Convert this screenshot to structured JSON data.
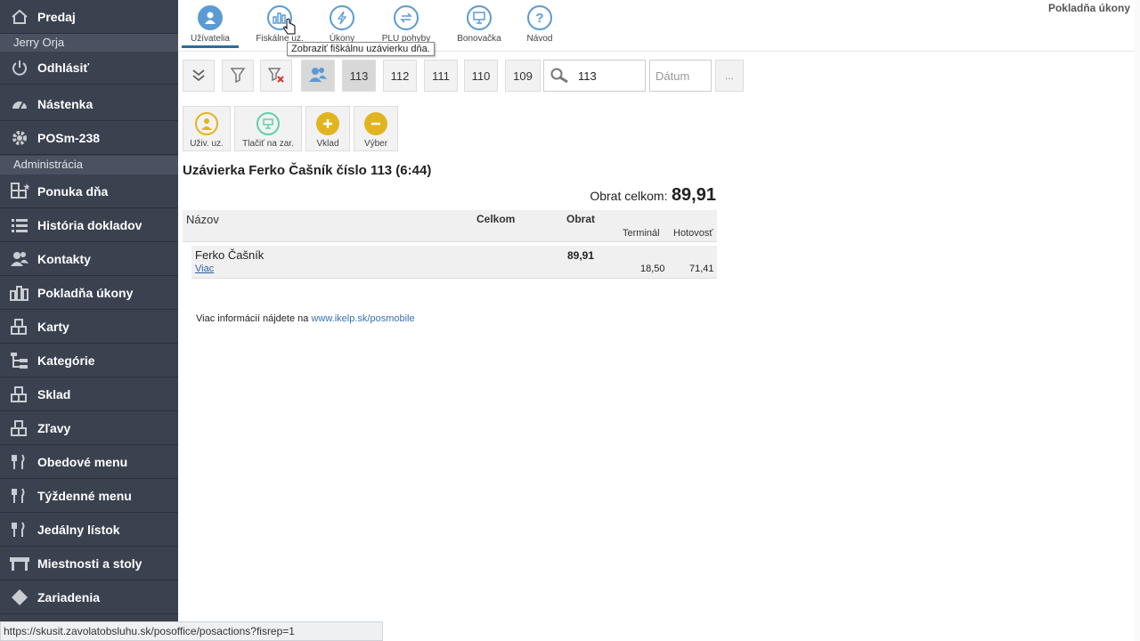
{
  "sidebar": {
    "predaj": "Predaj",
    "user_name": "Jerry Orja",
    "odhlasit": "Odhlásiť",
    "nastenka": "Nástenka",
    "device": "POSm-238",
    "admin_heading": "Administrácia",
    "items": [
      {
        "label": "Ponuka dňa",
        "icon": "grid-star-icon"
      },
      {
        "label": "História dokladov",
        "icon": "list-icon"
      },
      {
        "label": "Kontakty",
        "icon": "people-icon"
      },
      {
        "label": "Pokladňa úkony",
        "icon": "bar-chart-icon"
      },
      {
        "label": "Karty",
        "icon": "blocks-icon"
      },
      {
        "label": "Kategórie",
        "icon": "tree-icon"
      },
      {
        "label": "Sklad",
        "icon": "blocks-icon"
      },
      {
        "label": "Zľavy",
        "icon": "blocks-icon"
      },
      {
        "label": "Obedové menu",
        "icon": "fork-knife-icon"
      },
      {
        "label": "Týždenné menu",
        "icon": "fork-knife-icon"
      },
      {
        "label": "Jedálny lístok",
        "icon": "fork-knife-icon"
      },
      {
        "label": "Miestnosti a stoly",
        "icon": "table-icon"
      },
      {
        "label": "Zariadenia",
        "icon": "diamond-icon"
      }
    ]
  },
  "topbar": {
    "page_title": "Pokladňa úkony",
    "tabs": [
      {
        "label": "Užívatelia",
        "icon": "user-icon"
      },
      {
        "label": "Fiskálne uz.",
        "icon": "bar-chart-icon"
      },
      {
        "label": "Úkony",
        "icon": "bolt-icon"
      },
      {
        "label": "PLU pohyby",
        "icon": "swap-icon"
      },
      {
        "label": "Bonovačka",
        "icon": "printer-icon"
      },
      {
        "label": "Návod",
        "icon": "help-icon"
      }
    ],
    "tooltip": "Zobraziť fiškálnu uzávierku dňa."
  },
  "toolbar": {
    "numbers": [
      "113",
      "112",
      "111",
      "110",
      "109"
    ],
    "search_value": "113",
    "date_placeholder": "Dátum",
    "more_label": "..."
  },
  "actions": [
    {
      "label": "Uživ. uz.",
      "icon": "user-report-icon",
      "color": "#e0b520"
    },
    {
      "label": "Tlačiť na zar.",
      "icon": "printer-icon",
      "color": "#5fd1a8"
    },
    {
      "label": "Vklad",
      "icon": "plus-icon",
      "color": "#e0b520"
    },
    {
      "label": "Výber",
      "icon": "minus-icon",
      "color": "#e0b520"
    }
  ],
  "report": {
    "title": "Uzávierka Ferko Čašník číslo 113 (6:44)",
    "total_label": "Obrat celkom:",
    "total_value": "89,91",
    "columns": {
      "name": "Názov",
      "total": "Celkom",
      "turnover": "Obrat",
      "terminal": "Terminál",
      "cash": "Hotovosť"
    },
    "rows": [
      {
        "name": "Ferko Čašník",
        "link": "Viac",
        "turnover": "89,91",
        "terminal": "18,50",
        "cash": "71,41"
      }
    ]
  },
  "info": {
    "text": "Viac informácií nájdete na ",
    "link": "www.ikelp.sk/posmobile"
  },
  "status_url": "https://skusit.zavolatobsluhu.sk/posoffice/posactions?fisrep=1",
  "colors": {
    "sidebar_bg": "#3a4250",
    "accent": "#5b9bd5",
    "action_yellow": "#e0b520",
    "action_green": "#5fd1a8"
  }
}
